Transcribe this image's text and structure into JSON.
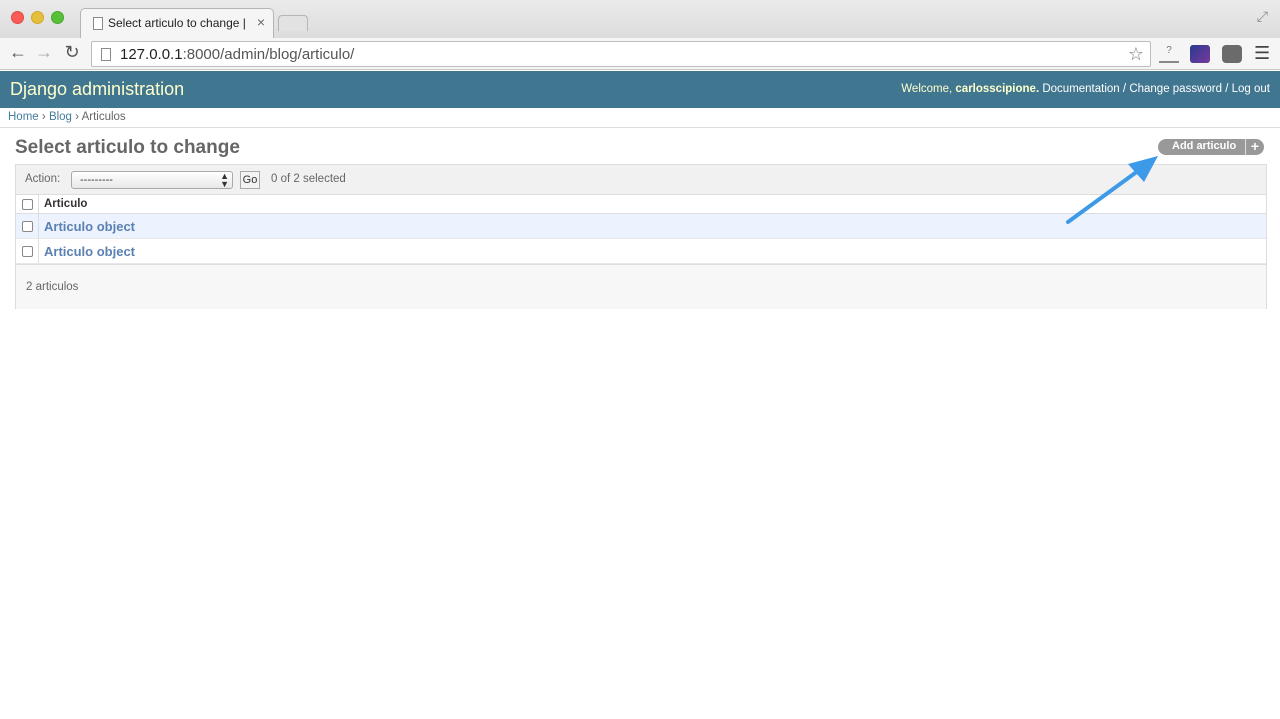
{
  "browser": {
    "tab_title": "Select articulo to change |",
    "url_host": "127.0.0.1",
    "url_rest": ":8000/admin/blog/articulo/"
  },
  "header": {
    "site_name": "Django administration",
    "welcome": "Welcome,",
    "username": "carlosscipione.",
    "documentation": "Documentation",
    "change_password": "Change password",
    "log_out": "Log out",
    "separator": "/"
  },
  "breadcrumbs": {
    "home": "Home",
    "app": "Blog",
    "current": "Articulos",
    "separator": "›"
  },
  "page": {
    "title": "Select articulo to change",
    "add_button": "Add articulo",
    "add_plus": "+"
  },
  "actions": {
    "label": "Action:",
    "selected_option": "---------",
    "go_label": "Go",
    "counter": "0 of 2 selected"
  },
  "results": {
    "column_header": "Articulo",
    "rows": [
      {
        "label": "Articulo object"
      },
      {
        "label": "Articulo object"
      }
    ],
    "count_text": "2 articulos"
  },
  "colors": {
    "header_bg": "#417690",
    "site_name": "#ffffcc",
    "link": "#5b80b2",
    "annotation_arrow": "#3d9ae8"
  }
}
